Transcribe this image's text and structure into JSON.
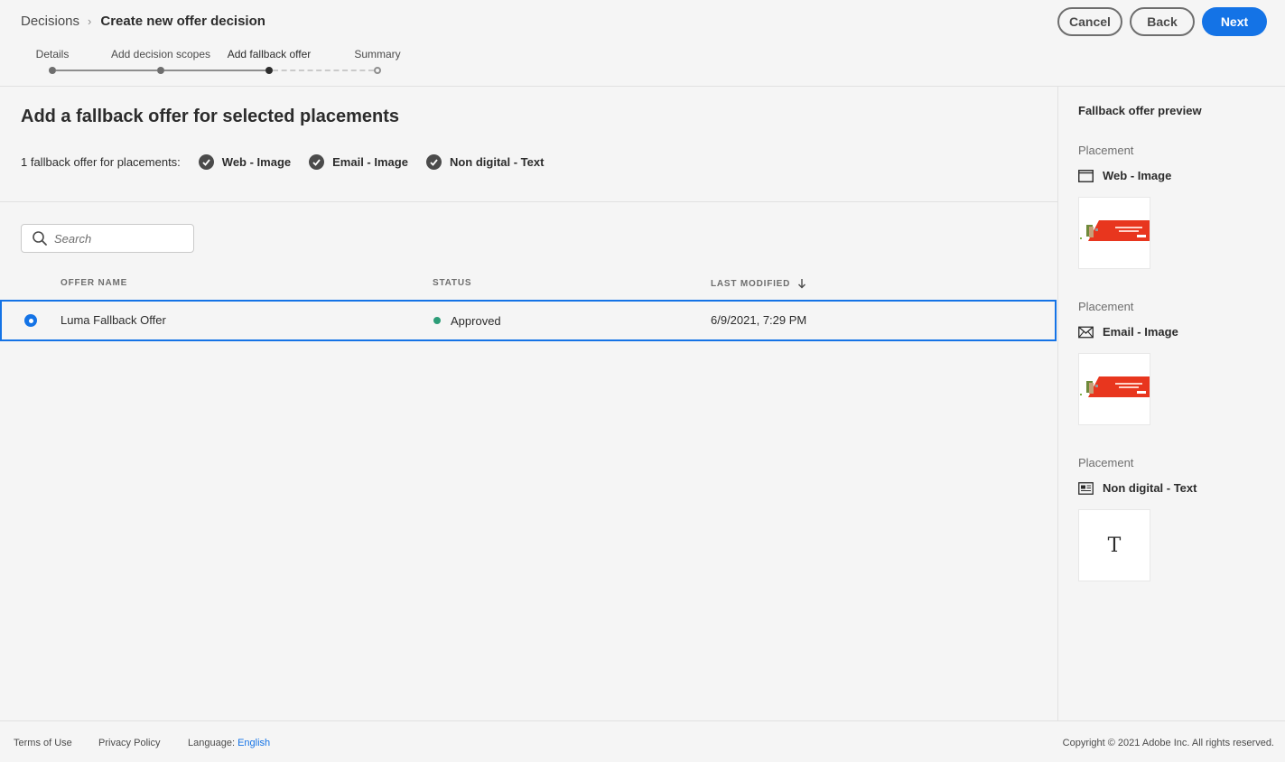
{
  "breadcrumb": {
    "parent": "Decisions",
    "separator": "›",
    "current": "Create new offer decision"
  },
  "header_buttons": {
    "cancel": "Cancel",
    "back": "Back",
    "next": "Next"
  },
  "stepper": {
    "steps": [
      {
        "label": "Details",
        "state": "done"
      },
      {
        "label": "Add decision scopes",
        "state": "done"
      },
      {
        "label": "Add fallback offer",
        "state": "current"
      },
      {
        "label": "Summary",
        "state": "future"
      }
    ]
  },
  "main": {
    "title": "Add a fallback offer for selected placements",
    "placements_prefix": "1 fallback offer for placements:",
    "placements": [
      "Web - Image",
      "Email - Image",
      "Non digital - Text"
    ],
    "search": {
      "placeholder": "Search",
      "value": ""
    },
    "table": {
      "columns": [
        "OFFER NAME",
        "STATUS",
        "LAST MODIFIED"
      ],
      "sort_column": "LAST MODIFIED",
      "sort_direction": "descending",
      "rows": [
        {
          "name": "Luma Fallback Offer",
          "status": "Approved",
          "modified": "6/9/2021, 7:29 PM",
          "selected": true
        }
      ]
    }
  },
  "preview": {
    "title": "Fallback offer preview",
    "items": [
      {
        "label": "Placement",
        "name": "Web - Image",
        "icon": "web-window-icon",
        "thumb": "image"
      },
      {
        "label": "Placement",
        "name": "Email - Image",
        "icon": "envelope-icon",
        "thumb": "image"
      },
      {
        "label": "Placement",
        "name": "Non digital - Text",
        "icon": "text-document-icon",
        "thumb": "text",
        "thumb_glyph": "T"
      }
    ]
  },
  "footer": {
    "terms": "Terms of Use",
    "privacy": "Privacy Policy",
    "language_label": "Language:",
    "language_value": "English",
    "copyright": "Copyright ©  2021 Adobe Inc.  All rights reserved."
  },
  "colors": {
    "accent": "#1473e6",
    "approved": "#2d9d78",
    "banner": "#e8361e"
  }
}
